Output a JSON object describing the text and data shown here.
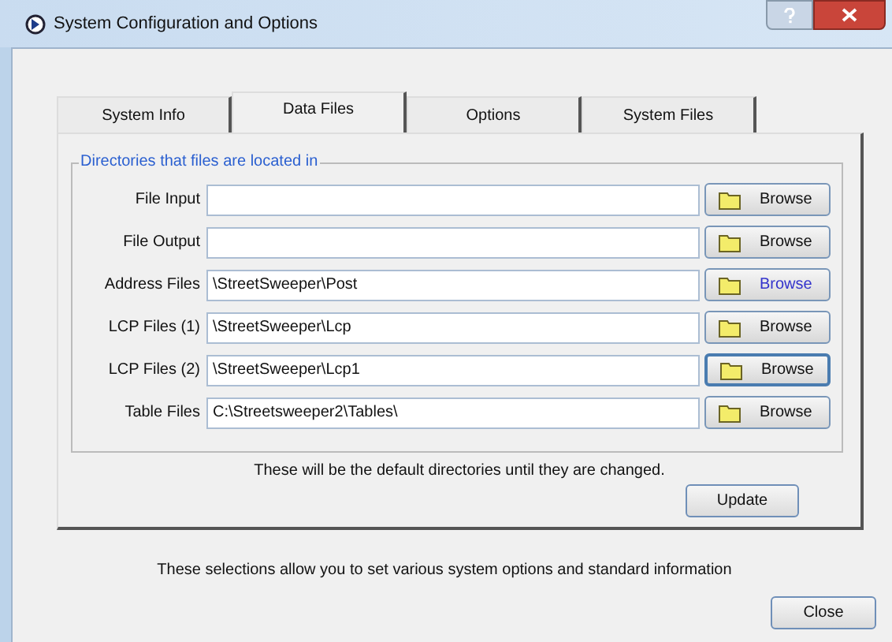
{
  "window": {
    "title": "System Configuration and Options"
  },
  "tabs": [
    {
      "label": "System Info",
      "selected": false
    },
    {
      "label": "Data Files",
      "selected": true
    },
    {
      "label": "Options",
      "selected": false
    },
    {
      "label": "System Files",
      "selected": false
    }
  ],
  "group": {
    "title": "Directories that files are located in",
    "rows": [
      {
        "label": "File Input",
        "value": "",
        "button": "Browse",
        "hovered": false,
        "focused": false
      },
      {
        "label": "File Output",
        "value": "",
        "button": "Browse",
        "hovered": false,
        "focused": false
      },
      {
        "label": "Address Files",
        "value": "\\StreetSweeper\\Post",
        "button": "Browse",
        "hovered": true,
        "focused": false
      },
      {
        "label": "LCP Files (1)",
        "value": "\\StreetSweeper\\Lcp",
        "button": "Browse",
        "hovered": false,
        "focused": false
      },
      {
        "label": "LCP Files (2)",
        "value": "\\StreetSweeper\\Lcp1",
        "button": "Browse",
        "hovered": false,
        "focused": true
      },
      {
        "label": "Table Files",
        "value": "C:\\Streetsweeper2\\Tables\\",
        "button": "Browse",
        "hovered": false,
        "focused": false
      }
    ]
  },
  "note": "These will be the default directories until they are changed.",
  "update_button": "Update",
  "footer_text": "These selections allow you to set various system options and standard information",
  "close_button": "Close"
}
